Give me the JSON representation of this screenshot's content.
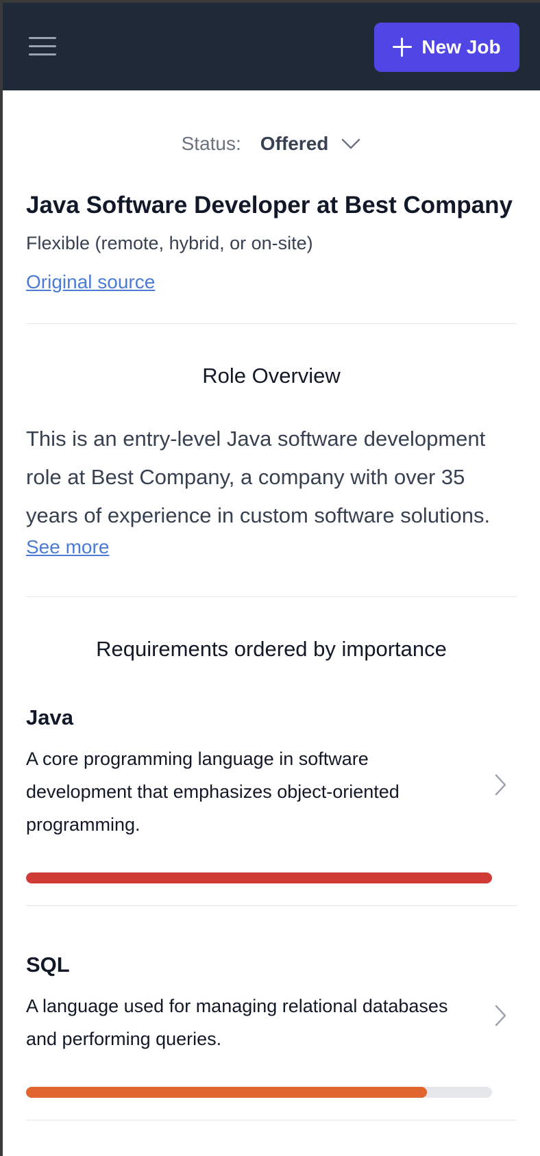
{
  "header": {
    "new_job_label": "New Job"
  },
  "status": {
    "label": "Status:",
    "value": "Offered"
  },
  "job": {
    "title": "Java Software Developer at Best Company",
    "location": "Flexible (remote, hybrid, or on-site)",
    "source_link": "Original source"
  },
  "overview": {
    "title": "Role Overview",
    "text": "This is an entry-level Java software development role at Best Company, a company with over 35 years of experience in custom software solutions.",
    "see_more": "See more"
  },
  "requirements": {
    "title": "Requirements ordered by importance",
    "items": [
      {
        "name": "Java",
        "description": "A core programming language in software development that emphasizes object-oriented programming.",
        "importance": 1.0,
        "color": "#d13b35"
      },
      {
        "name": "SQL",
        "description": "A language used for managing relational databases and performing queries.",
        "importance": 0.86,
        "color": "#e0652f"
      }
    ]
  },
  "colors": {
    "accent": "#4f46e5",
    "topbar": "#1f2937",
    "link": "#4b7bd4"
  }
}
